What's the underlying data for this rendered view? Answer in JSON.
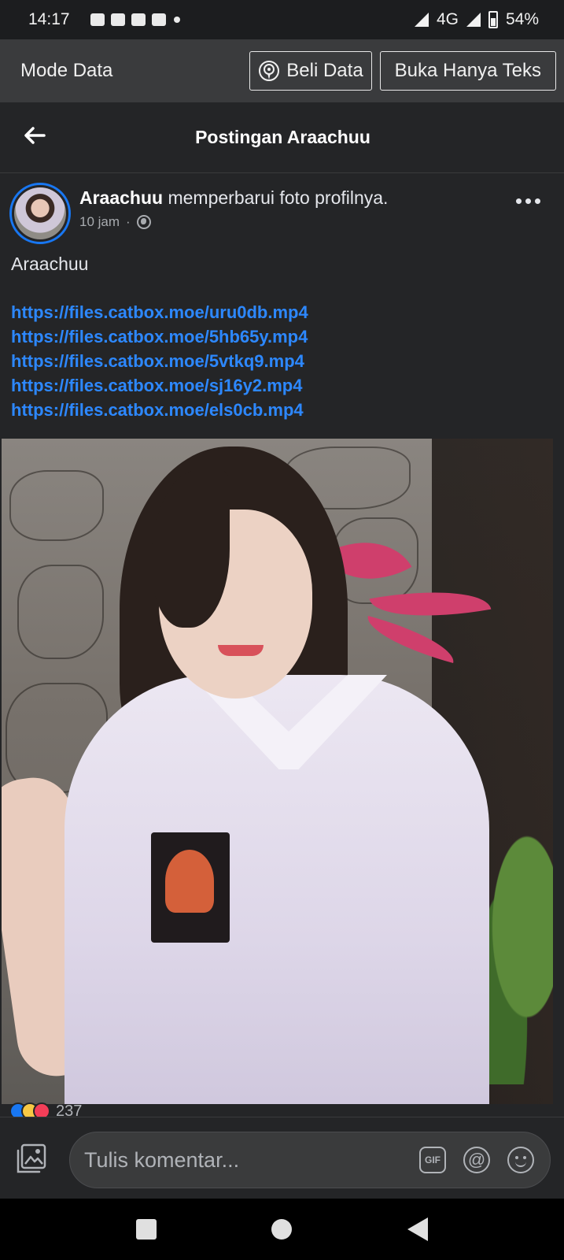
{
  "status_bar": {
    "time": "14:17",
    "network": "4G",
    "battery": "54%"
  },
  "data_bar": {
    "mode_label": "Mode Data",
    "buy_data_label": "Beli Data",
    "text_only_label": "Buka Hanya Teks"
  },
  "header": {
    "title": "Postingan Araachuu"
  },
  "post": {
    "author": "Araachuu",
    "action": " memperbarui foto profilnya.",
    "time": "10 jam",
    "separator": "·",
    "text": "Araachuu",
    "links": [
      "https://files.catbox.moe/uru0db.mp4",
      "https://files.catbox.moe/5hb65y.mp4",
      "https://files.catbox.moe/5vtkq9.mp4",
      "https://files.catbox.moe/sj16y2.mp4",
      "https://files.catbox.moe/els0cb.mp4"
    ],
    "reaction_count": "237"
  },
  "comment_bar": {
    "placeholder": "Tulis komentar...",
    "gif_label": "GIF",
    "at_label": "@"
  },
  "icons": {
    "back": "arrow-left-icon",
    "podcast": "broadcast-icon",
    "globe": "globe-icon",
    "more": "more-dots-icon",
    "photo": "photo-icon"
  },
  "colors": {
    "link": "#2d88ff",
    "avatar_ring": "#1877f2",
    "background": "#242527"
  }
}
